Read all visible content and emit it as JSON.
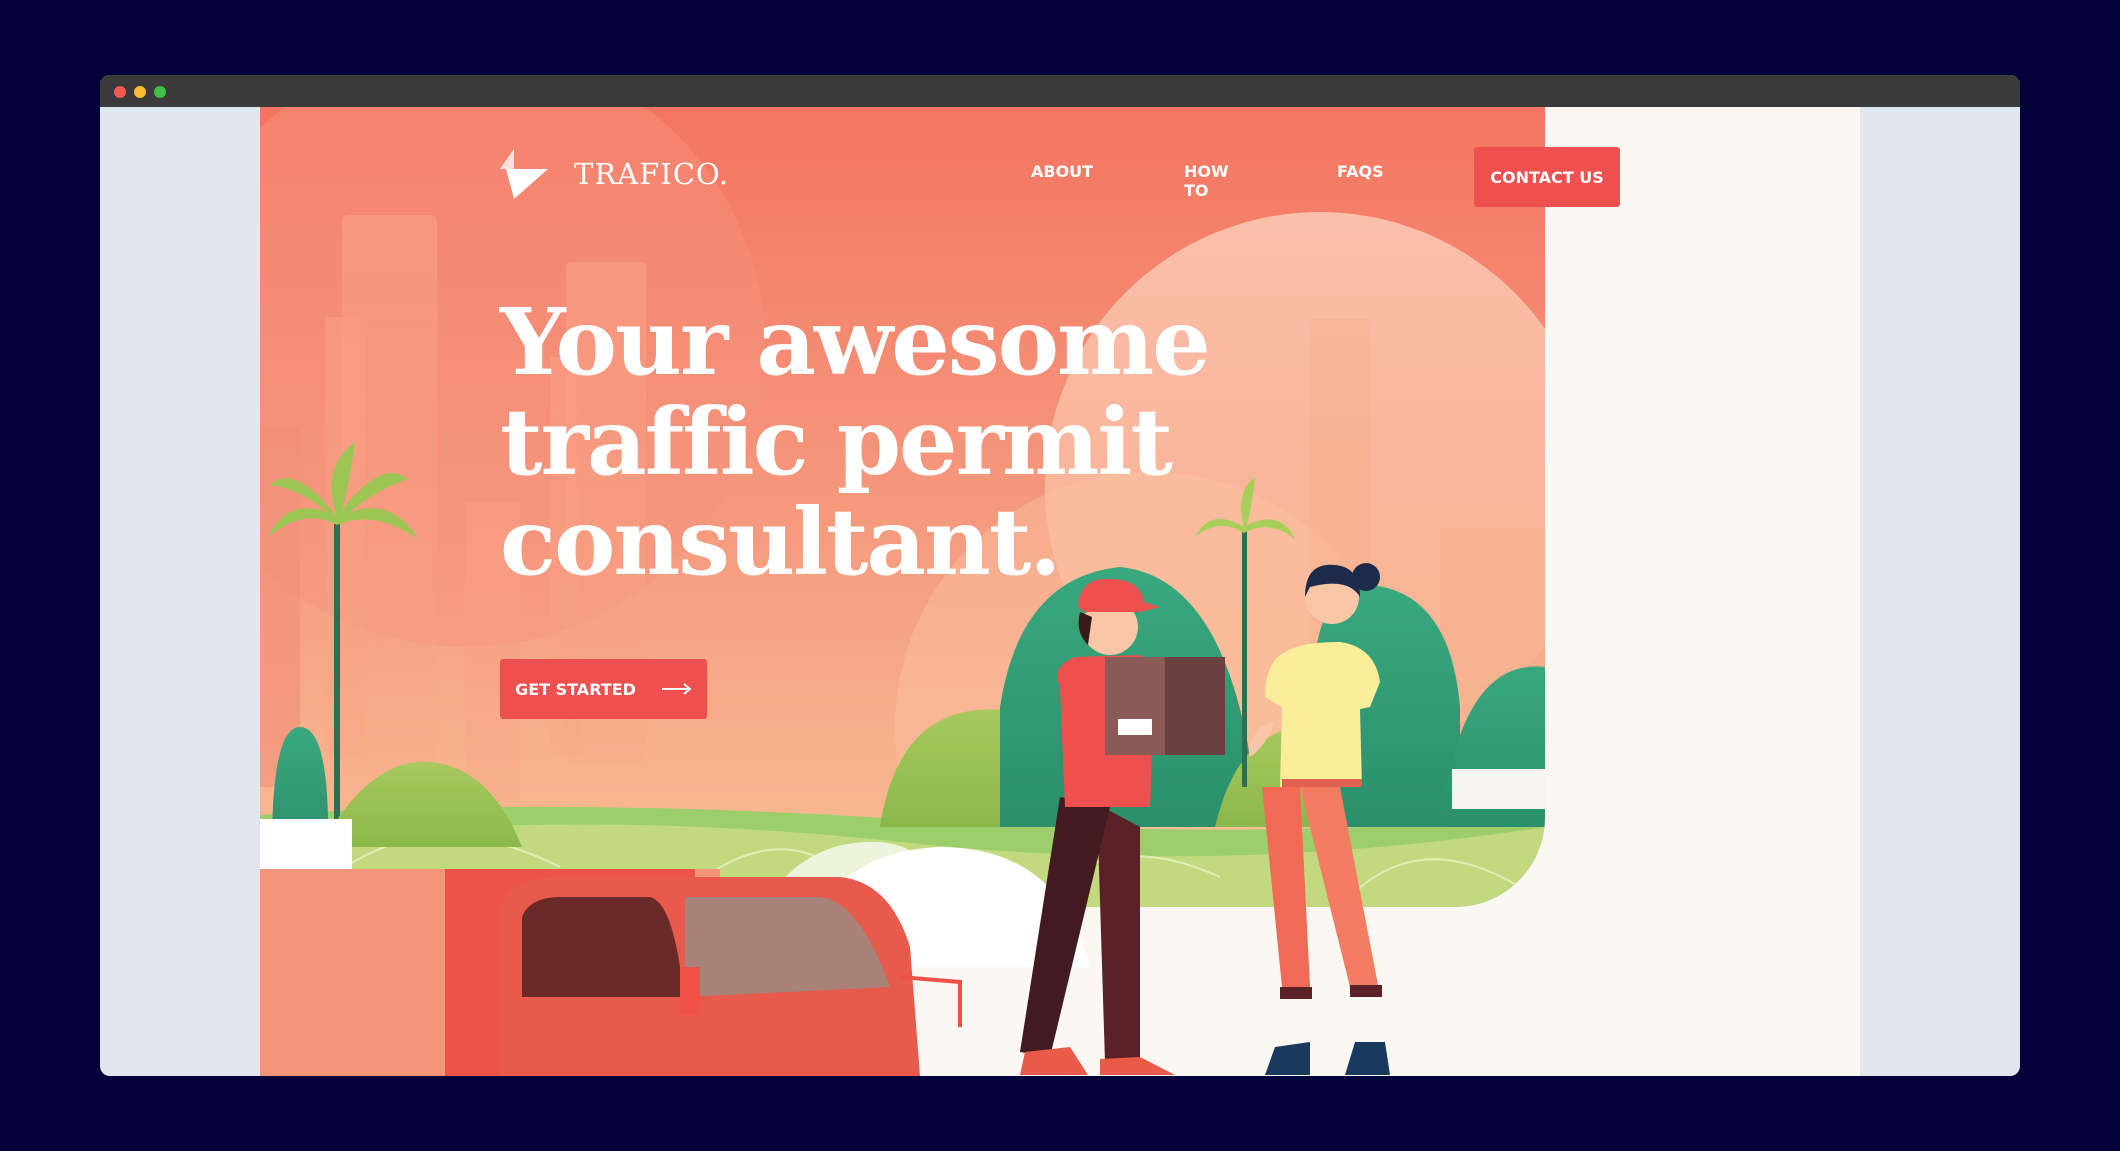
{
  "brand": {
    "name": "TRAFICO.",
    "logo_icon": "triangle-logo-icon"
  },
  "nav": {
    "items": [
      {
        "label": "ABOUT"
      },
      {
        "label": "HOW TO"
      },
      {
        "label": "FAQS"
      }
    ],
    "contact_label": "CONTACT US"
  },
  "hero": {
    "headline_lines": [
      "Your awesome",
      "traffic permit",
      "consultant."
    ],
    "cta_label": "GET STARTED",
    "cta_icon": "arrow-right-icon"
  },
  "colors": {
    "accent": "#ee4f4f",
    "hero_top": "#f47561",
    "hero_bottom": "#f8c08f",
    "frame": "#03023a",
    "grass": "#b9d47a",
    "foliage": "#3aa67f"
  }
}
